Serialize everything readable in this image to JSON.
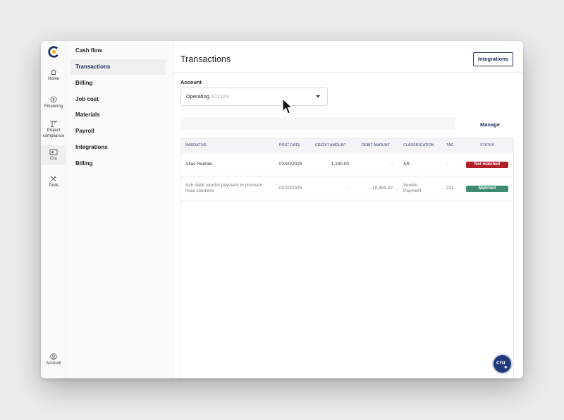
{
  "rail": {
    "items": [
      {
        "label": "Home",
        "icon": "home-icon"
      },
      {
        "label": "Financing",
        "icon": "dollar-icon"
      },
      {
        "label": "Project compliance",
        "icon": "crane-icon"
      },
      {
        "label": "Cru",
        "icon": "cru-card-icon"
      },
      {
        "label": "Tools",
        "icon": "tools-icon"
      }
    ],
    "account_label": "Account"
  },
  "subnav": {
    "items": [
      "Cash flow",
      "Transactions",
      "Billing",
      "Job cost",
      "Materials",
      "Payroll",
      "Integrations",
      "Billing"
    ],
    "active_index": 1
  },
  "main": {
    "title": "Transactions",
    "integrations_button": "Integrations",
    "account_label": "Account",
    "account_select": {
      "name": "Operating",
      "number": "101323"
    },
    "manage_link": "Manage"
  },
  "table": {
    "columns": [
      "NARRATIVE",
      "POST DATE",
      "CREDIT AMOUNT",
      "DEBIT AMOUNT",
      "CLASSIFICATION",
      "TAG",
      "STATUS"
    ],
    "rows": [
      {
        "narrative_line1": "Atlas Rentals",
        "narrative_line2": "",
        "post_date": "02/10/2025",
        "credit": "1,240.00",
        "debit": "-",
        "classification_line1": "AR",
        "classification_line2": "",
        "tag": "-",
        "status": "Not matched"
      },
      {
        "narrative_line1": "Ach debit vendor payment to precison",
        "narrative_line2": "hvac solutions",
        "post_date": "02/10/2025",
        "credit": "-",
        "debit": "-18,455.22",
        "classification_line1": "Vendor",
        "classification_line2": "Payment",
        "tag": "221",
        "status": "Matched"
      }
    ]
  },
  "fab": {
    "label": "cru"
  },
  "colors": {
    "brand_navy": "#1f2a5a",
    "not_matched": "#b3202a",
    "matched": "#3d8a70",
    "logo_yellow": "#f2b824"
  }
}
